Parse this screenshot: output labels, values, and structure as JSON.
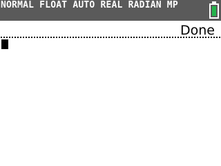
{
  "status_bar": {
    "mode": "NORMAL FLOAT AUTO REAL RADIAN MP",
    "battery_icon": "battery-full-icon",
    "battery_color": "#23b34a",
    "bar_color": "#5a5a5a"
  },
  "home_screen": {
    "history": [
      {
        "result": "Done"
      }
    ],
    "cursor_icon": "block-cursor"
  }
}
